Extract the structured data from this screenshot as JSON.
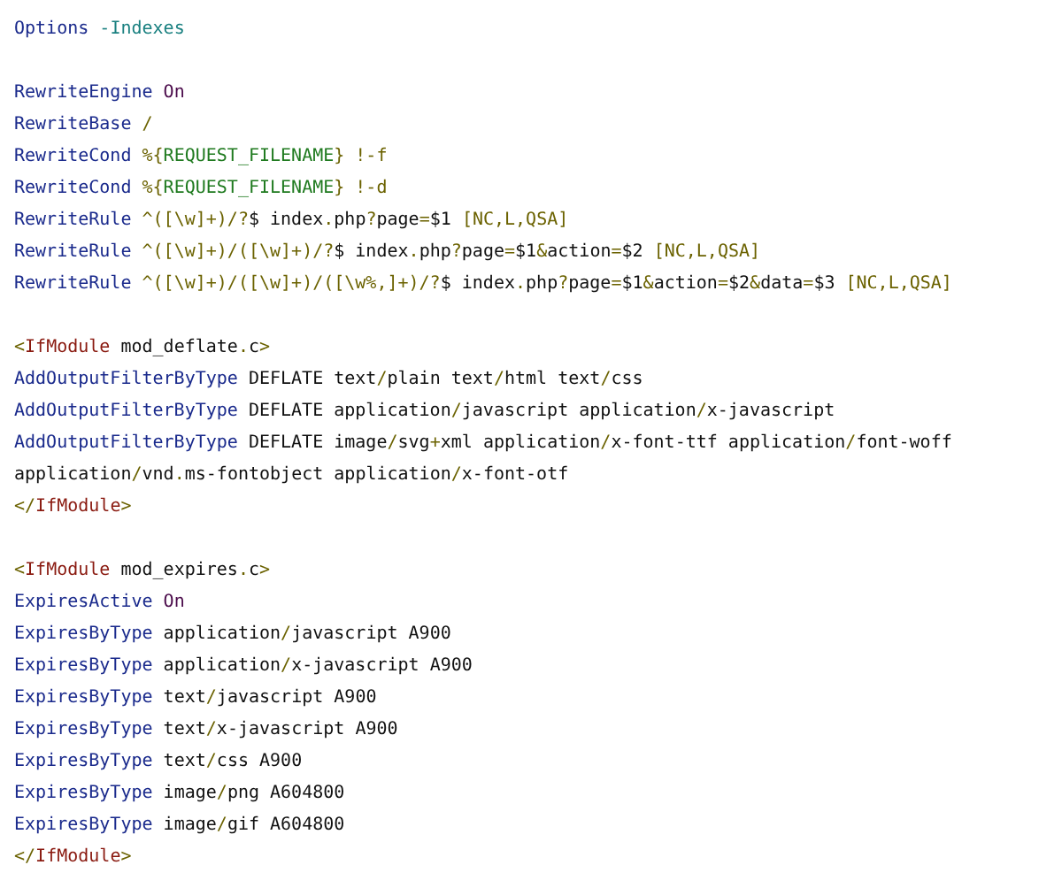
{
  "code_blocks": [
    {
      "lines": [
        {
          "tokens": [
            {
              "kind": "directive",
              "text": "Options"
            },
            {
              "kind": "flag",
              "text": " -Indexes"
            }
          ]
        }
      ]
    },
    {
      "lines": [
        {
          "tokens": [
            {
              "kind": "directive",
              "text": "RewriteEngine"
            },
            {
              "kind": "keyword",
              "text": " On"
            }
          ]
        },
        {
          "tokens": [
            {
              "kind": "directive",
              "text": "RewriteBase"
            },
            {
              "kind": "punct",
              "text": " /"
            }
          ]
        },
        {
          "tokens": [
            {
              "kind": "directive",
              "text": "RewriteCond"
            },
            {
              "kind": "punct",
              "text": " %{"
            },
            {
              "kind": "variable",
              "text": "REQUEST_FILENAME"
            },
            {
              "kind": "punct",
              "text": "} !-f"
            }
          ]
        },
        {
          "tokens": [
            {
              "kind": "directive",
              "text": "RewriteCond"
            },
            {
              "kind": "punct",
              "text": " %{"
            },
            {
              "kind": "variable",
              "text": "REQUEST_FILENAME"
            },
            {
              "kind": "punct",
              "text": "} !-d"
            }
          ]
        },
        {
          "tokens": [
            {
              "kind": "directive",
              "text": "RewriteRule"
            },
            {
              "kind": "punct",
              "text": " ^([\\w]+)/?"
            },
            {
              "kind": "plain",
              "text": "$ index"
            },
            {
              "kind": "punct",
              "text": "."
            },
            {
              "kind": "plain",
              "text": "php"
            },
            {
              "kind": "punct",
              "text": "?"
            },
            {
              "kind": "plain",
              "text": "page"
            },
            {
              "kind": "punct",
              "text": "="
            },
            {
              "kind": "plain",
              "text": "$1 "
            },
            {
              "kind": "punct",
              "text": "[NC,L,QSA]"
            }
          ]
        },
        {
          "tokens": [
            {
              "kind": "directive",
              "text": "RewriteRule"
            },
            {
              "kind": "punct",
              "text": " ^([\\w]+)/([\\w]+)/?"
            },
            {
              "kind": "plain",
              "text": "$ index"
            },
            {
              "kind": "punct",
              "text": "."
            },
            {
              "kind": "plain",
              "text": "php"
            },
            {
              "kind": "punct",
              "text": "?"
            },
            {
              "kind": "plain",
              "text": "page"
            },
            {
              "kind": "punct",
              "text": "="
            },
            {
              "kind": "plain",
              "text": "$1"
            },
            {
              "kind": "punct",
              "text": "&"
            },
            {
              "kind": "plain",
              "text": "action"
            },
            {
              "kind": "punct",
              "text": "="
            },
            {
              "kind": "plain",
              "text": "$2 "
            },
            {
              "kind": "punct",
              "text": "[NC,L,QSA]"
            }
          ]
        },
        {
          "tokens": [
            {
              "kind": "directive",
              "text": "RewriteRule"
            },
            {
              "kind": "punct",
              "text": " ^([\\w]+)/([\\w]+)/([\\w%,]+)/?"
            },
            {
              "kind": "plain",
              "text": "$ index"
            },
            {
              "kind": "punct",
              "text": "."
            },
            {
              "kind": "plain",
              "text": "php"
            },
            {
              "kind": "punct",
              "text": "?"
            },
            {
              "kind": "plain",
              "text": "page"
            },
            {
              "kind": "punct",
              "text": "="
            },
            {
              "kind": "plain",
              "text": "$1"
            },
            {
              "kind": "punct",
              "text": "&"
            },
            {
              "kind": "plain",
              "text": "action"
            },
            {
              "kind": "punct",
              "text": "="
            },
            {
              "kind": "plain",
              "text": "$2"
            },
            {
              "kind": "punct",
              "text": "&"
            },
            {
              "kind": "plain",
              "text": "data"
            },
            {
              "kind": "punct",
              "text": "="
            },
            {
              "kind": "plain",
              "text": "$3 "
            },
            {
              "kind": "punct",
              "text": "[NC,L,QSA]"
            }
          ]
        }
      ]
    },
    {
      "lines": [
        {
          "tokens": [
            {
              "kind": "punct",
              "text": "<"
            },
            {
              "kind": "tag",
              "text": "IfModule"
            },
            {
              "kind": "plain",
              "text": " mod_deflate"
            },
            {
              "kind": "punct",
              "text": "."
            },
            {
              "kind": "plain",
              "text": "c"
            },
            {
              "kind": "punct",
              "text": ">"
            }
          ]
        },
        {
          "tokens": [
            {
              "kind": "directive",
              "text": "AddOutputFilterByType"
            },
            {
              "kind": "plain",
              "text": " DEFLATE text"
            },
            {
              "kind": "punct",
              "text": "/"
            },
            {
              "kind": "plain",
              "text": "plain text"
            },
            {
              "kind": "punct",
              "text": "/"
            },
            {
              "kind": "plain",
              "text": "html text"
            },
            {
              "kind": "punct",
              "text": "/"
            },
            {
              "kind": "plain",
              "text": "css"
            }
          ]
        },
        {
          "tokens": [
            {
              "kind": "directive",
              "text": "AddOutputFilterByType"
            },
            {
              "kind": "plain",
              "text": " DEFLATE application"
            },
            {
              "kind": "punct",
              "text": "/"
            },
            {
              "kind": "plain",
              "text": "javascript application"
            },
            {
              "kind": "punct",
              "text": "/"
            },
            {
              "kind": "plain",
              "text": "x-javascript"
            }
          ]
        },
        {
          "tokens": [
            {
              "kind": "directive",
              "text": "AddOutputFilterByType"
            },
            {
              "kind": "plain",
              "text": " DEFLATE image"
            },
            {
              "kind": "punct",
              "text": "/"
            },
            {
              "kind": "plain",
              "text": "svg"
            },
            {
              "kind": "punct",
              "text": "+"
            },
            {
              "kind": "plain",
              "text": "xml application"
            },
            {
              "kind": "punct",
              "text": "/"
            },
            {
              "kind": "plain",
              "text": "x-font-ttf application"
            },
            {
              "kind": "punct",
              "text": "/"
            },
            {
              "kind": "plain",
              "text": "font-woff"
            }
          ]
        },
        {
          "tokens": [
            {
              "kind": "plain",
              "text": "application"
            },
            {
              "kind": "punct",
              "text": "/"
            },
            {
              "kind": "plain",
              "text": "vnd"
            },
            {
              "kind": "punct",
              "text": "."
            },
            {
              "kind": "plain",
              "text": "ms-fontobject application"
            },
            {
              "kind": "punct",
              "text": "/"
            },
            {
              "kind": "plain",
              "text": "x-font-otf"
            }
          ]
        },
        {
          "tokens": [
            {
              "kind": "punct",
              "text": "</"
            },
            {
              "kind": "tag",
              "text": "IfModule"
            },
            {
              "kind": "punct",
              "text": ">"
            }
          ]
        }
      ]
    },
    {
      "lines": [
        {
          "tokens": [
            {
              "kind": "punct",
              "text": "<"
            },
            {
              "kind": "tag",
              "text": "IfModule"
            },
            {
              "kind": "plain",
              "text": " mod_expires"
            },
            {
              "kind": "punct",
              "text": "."
            },
            {
              "kind": "plain",
              "text": "c"
            },
            {
              "kind": "punct",
              "text": ">"
            }
          ]
        },
        {
          "tokens": [
            {
              "kind": "directive",
              "text": "ExpiresActive"
            },
            {
              "kind": "keyword",
              "text": " On"
            }
          ]
        },
        {
          "tokens": [
            {
              "kind": "directive",
              "text": "ExpiresByType"
            },
            {
              "kind": "plain",
              "text": " application"
            },
            {
              "kind": "punct",
              "text": "/"
            },
            {
              "kind": "plain",
              "text": "javascript A900"
            }
          ]
        },
        {
          "tokens": [
            {
              "kind": "directive",
              "text": "ExpiresByType"
            },
            {
              "kind": "plain",
              "text": " application"
            },
            {
              "kind": "punct",
              "text": "/"
            },
            {
              "kind": "plain",
              "text": "x-javascript A900"
            }
          ]
        },
        {
          "tokens": [
            {
              "kind": "directive",
              "text": "ExpiresByType"
            },
            {
              "kind": "plain",
              "text": " text"
            },
            {
              "kind": "punct",
              "text": "/"
            },
            {
              "kind": "plain",
              "text": "javascript A900"
            }
          ]
        },
        {
          "tokens": [
            {
              "kind": "directive",
              "text": "ExpiresByType"
            },
            {
              "kind": "plain",
              "text": " text"
            },
            {
              "kind": "punct",
              "text": "/"
            },
            {
              "kind": "plain",
              "text": "x-javascript A900"
            }
          ]
        },
        {
          "tokens": [
            {
              "kind": "directive",
              "text": "ExpiresByType"
            },
            {
              "kind": "plain",
              "text": " text"
            },
            {
              "kind": "punct",
              "text": "/"
            },
            {
              "kind": "plain",
              "text": "css A900"
            }
          ]
        },
        {
          "tokens": [
            {
              "kind": "directive",
              "text": "ExpiresByType"
            },
            {
              "kind": "plain",
              "text": " image"
            },
            {
              "kind": "punct",
              "text": "/"
            },
            {
              "kind": "plain",
              "text": "png A604800"
            }
          ]
        },
        {
          "tokens": [
            {
              "kind": "directive",
              "text": "ExpiresByType"
            },
            {
              "kind": "plain",
              "text": " image"
            },
            {
              "kind": "punct",
              "text": "/"
            },
            {
              "kind": "plain",
              "text": "gif A604800"
            }
          ]
        },
        {
          "tokens": [
            {
              "kind": "punct",
              "text": "</"
            },
            {
              "kind": "tag",
              "text": "IfModule"
            },
            {
              "kind": "punct",
              "text": ">"
            }
          ]
        }
      ]
    }
  ]
}
